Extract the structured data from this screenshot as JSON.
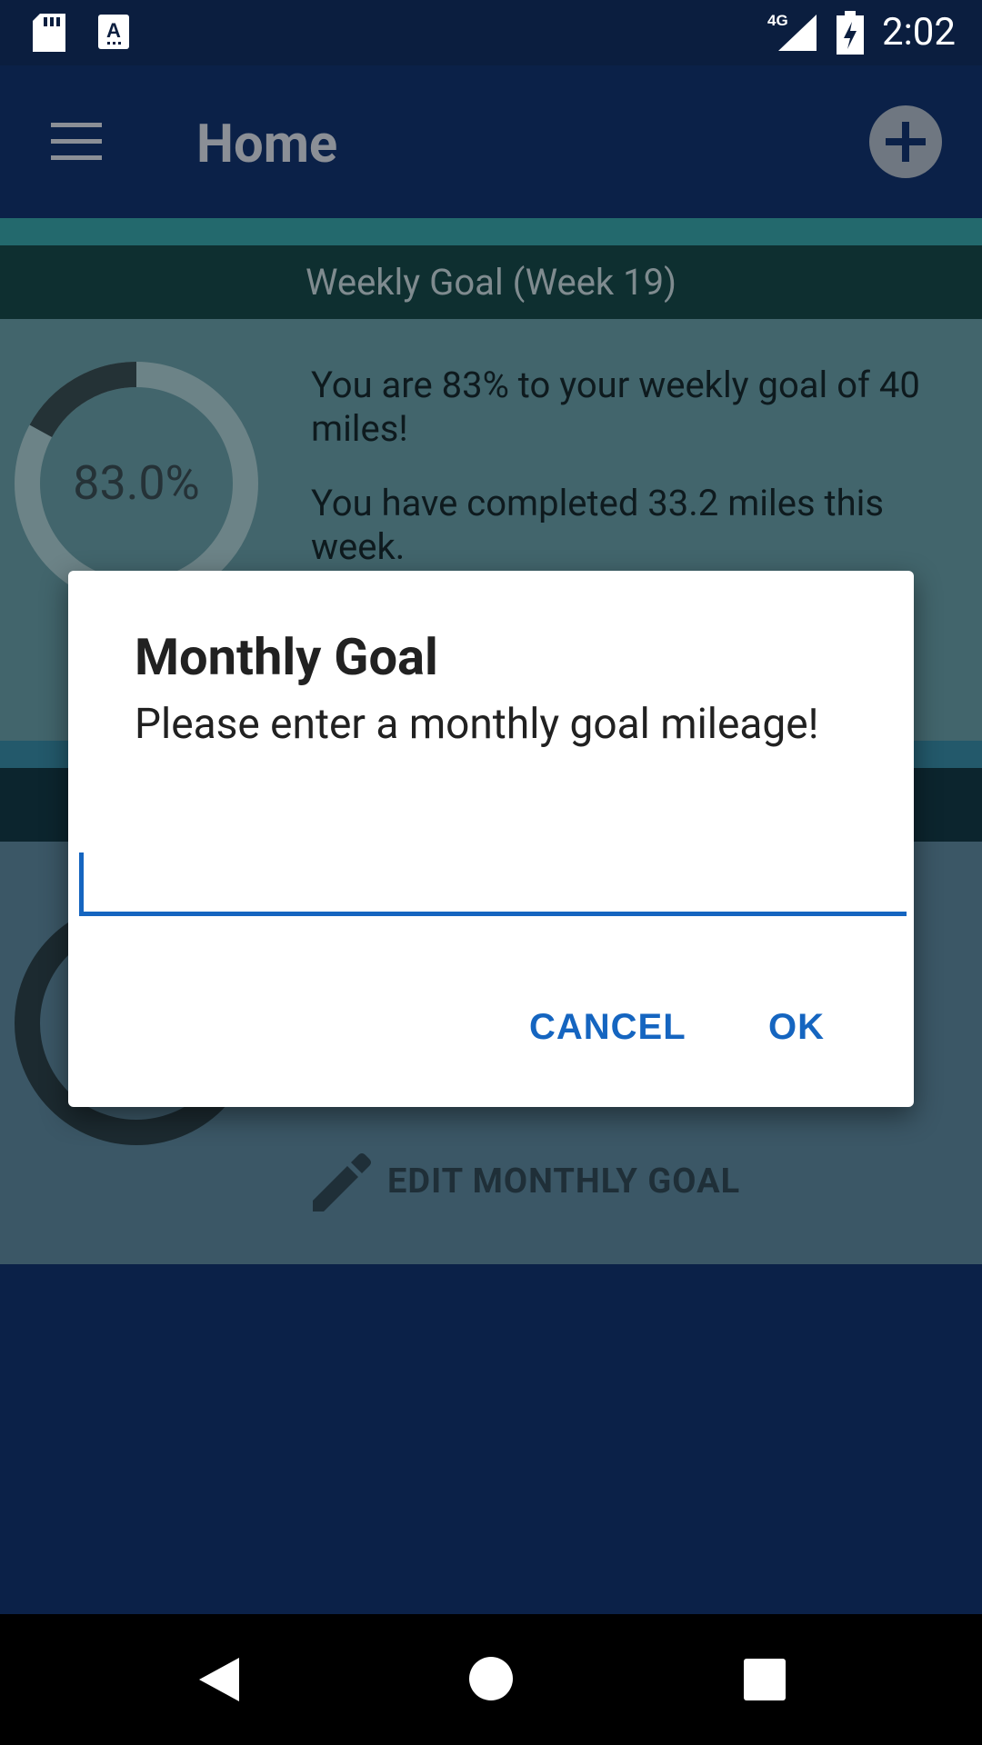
{
  "status_bar": {
    "time": "2:02",
    "network": "4G"
  },
  "app_bar": {
    "title": "Home"
  },
  "weekly_card": {
    "header": "Weekly Goal (Week 19)",
    "percent_label": "83.0%",
    "progress": 0.83,
    "line1": "You are 83% to your weekly goal of 40 miles!",
    "line2": "You have completed 33.2 miles this week."
  },
  "monthly_card": {
    "edit_label": "EDIT MONTHLY GOAL"
  },
  "dialog": {
    "title": "Monthly Goal",
    "message": "Please enter a monthly goal mileage!",
    "input_value": "",
    "cancel_label": "CANCEL",
    "ok_label": "OK"
  },
  "colors": {
    "accent": "#1565c0",
    "app_bar": "#0b2148",
    "dialog_bg": "#ffffff"
  }
}
